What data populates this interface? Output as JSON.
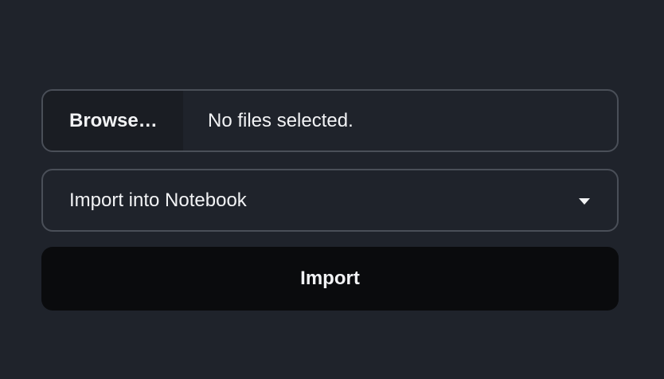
{
  "file_input": {
    "browse_label": "Browse…",
    "status_text": "No files selected."
  },
  "destination_select": {
    "selected_value": "Import into Notebook",
    "icon": "chevron-down-icon"
  },
  "import_button": {
    "label": "Import"
  },
  "colors": {
    "background": "#1f232b",
    "border": "#4a4f58",
    "browse_background": "#1a1d23",
    "button_background": "#0a0b0d",
    "text": "#f2f3f5"
  }
}
